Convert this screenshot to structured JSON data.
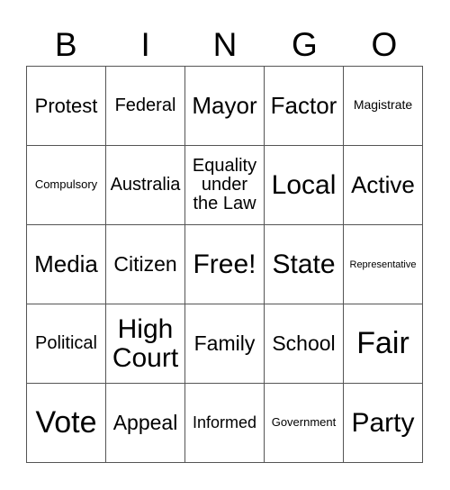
{
  "title_letters": [
    "B",
    "I",
    "N",
    "G",
    "O"
  ],
  "cells": [
    [
      {
        "text": "Protest",
        "size": 22
      },
      {
        "text": "Federal",
        "size": 20
      },
      {
        "text": "Mayor",
        "size": 26
      },
      {
        "text": "Factor",
        "size": 26
      },
      {
        "text": "Magistrate",
        "size": 14
      }
    ],
    [
      {
        "text": "Compulsory",
        "size": 13
      },
      {
        "text": "Australia",
        "size": 20
      },
      {
        "text": "Equality under the Law",
        "size": 20,
        "lines": [
          "Equality",
          "under",
          "the Law"
        ]
      },
      {
        "text": "Local",
        "size": 30
      },
      {
        "text": "Active",
        "size": 26
      }
    ],
    [
      {
        "text": "Media",
        "size": 26
      },
      {
        "text": "Citizen",
        "size": 23
      },
      {
        "text": "Free!",
        "size": 30
      },
      {
        "text": "State",
        "size": 30
      },
      {
        "text": "Representative",
        "size": 11
      }
    ],
    [
      {
        "text": "Political",
        "size": 20
      },
      {
        "text": "High Court",
        "size": 30,
        "lines": [
          "High",
          "Court"
        ]
      },
      {
        "text": "Family",
        "size": 23
      },
      {
        "text": "School",
        "size": 23
      },
      {
        "text": "Fair",
        "size": 34
      }
    ],
    [
      {
        "text": "Vote",
        "size": 34
      },
      {
        "text": "Appeal",
        "size": 23
      },
      {
        "text": "Informed",
        "size": 18
      },
      {
        "text": "Government",
        "size": 13
      },
      {
        "text": "Party",
        "size": 30
      }
    ]
  ]
}
